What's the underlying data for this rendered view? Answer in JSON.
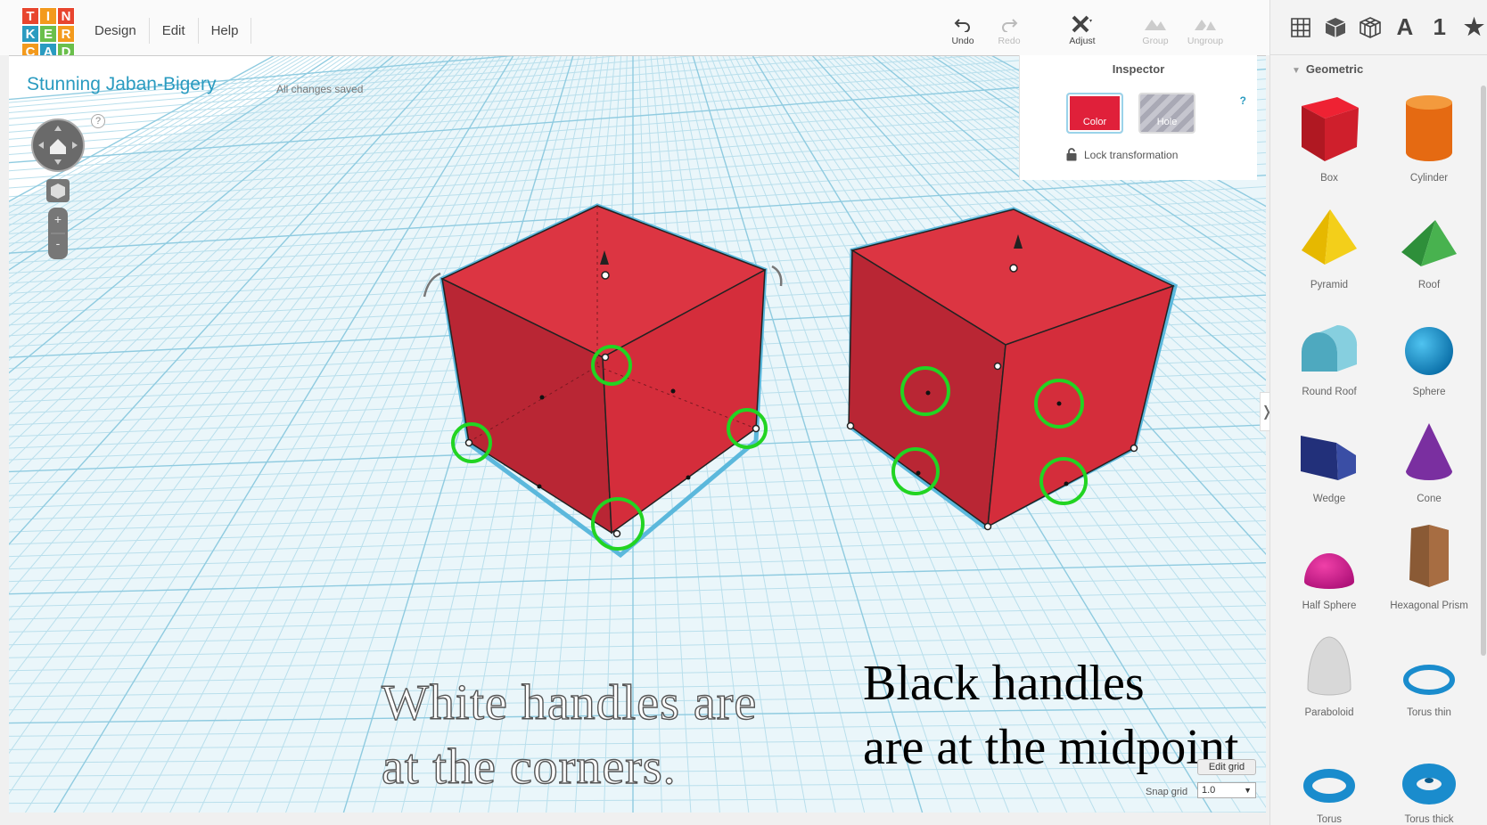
{
  "logo": {
    "letters": [
      "T",
      "I",
      "N",
      "K",
      "E",
      "R",
      "C",
      "A",
      "D"
    ],
    "colors": [
      "#e8452e",
      "#f39a1d",
      "#e8452e",
      "#2a9bc0",
      "#6abf4b",
      "#f39a1d",
      "#f39a1d",
      "#2a9bc0",
      "#6abf4b"
    ]
  },
  "menu": [
    {
      "label": "Design"
    },
    {
      "label": "Edit"
    },
    {
      "label": "Help"
    }
  ],
  "toolbar": {
    "undo": "Undo",
    "redo": "Redo",
    "adjust": "Adjust",
    "group": "Group",
    "ungroup": "Ungroup"
  },
  "project": {
    "title": "Stunning Jaban-Bigery",
    "status": "All changes saved"
  },
  "nav": {
    "help": "?"
  },
  "inspector": {
    "title": "Inspector",
    "color_label": "Color",
    "hole_label": "Hole",
    "help": "?",
    "lock_label": "Lock transformation",
    "color_value": "#e0203a"
  },
  "side_tools": {
    "text_tool": "A",
    "number_tool": "1",
    "star_tool": "★"
  },
  "geometric": {
    "header": "Geometric",
    "shapes": [
      {
        "name": "Box",
        "icon": "box-icon"
      },
      {
        "name": "Cylinder",
        "icon": "cylinder-icon"
      },
      {
        "name": "Pyramid",
        "icon": "pyramid-icon"
      },
      {
        "name": "Roof",
        "icon": "roof-icon"
      },
      {
        "name": "Round Roof",
        "icon": "round-roof-icon"
      },
      {
        "name": "Sphere",
        "icon": "sphere-icon"
      },
      {
        "name": "Wedge",
        "icon": "wedge-icon"
      },
      {
        "name": "Cone",
        "icon": "cone-icon"
      },
      {
        "name": "Half Sphere",
        "icon": "half-sphere-icon"
      },
      {
        "name": "Hexagonal Prism",
        "icon": "hexagonal-prism-icon"
      },
      {
        "name": "Paraboloid",
        "icon": "paraboloid-icon"
      },
      {
        "name": "Torus thin",
        "icon": "torus-thin-icon"
      },
      {
        "name": "Torus",
        "icon": "torus-icon"
      },
      {
        "name": "Torus thick",
        "icon": "torus-thick-icon"
      }
    ]
  },
  "grid": {
    "edit_label": "Edit grid",
    "snap_label": "Snap grid",
    "snap_value": "1.0"
  },
  "annotations": {
    "white_line1": "White handles are",
    "white_line2": "at the corners.",
    "black_line1": "Black handles",
    "black_line2": "are at the midpoint"
  },
  "collapse": "❭"
}
